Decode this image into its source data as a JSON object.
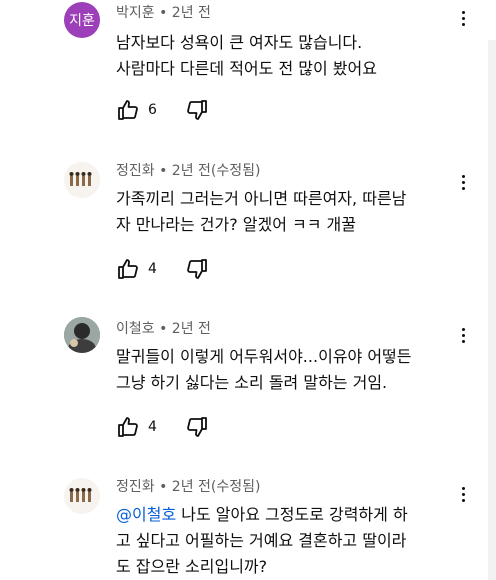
{
  "comments": [
    {
      "avatar_text": "지훈",
      "avatar_color": "#9c3fb8",
      "meta": "박지훈 • 2년 전",
      "lines": [
        "남자보다 성욕이 큰 여자도 많습니다.",
        "사람마다 다른데 적어도 전 많이 봤어요"
      ],
      "likes": "6"
    },
    {
      "meta": "정진화 • 2년 전(수정됨)",
      "lines": [
        "가족끼리 그러는거 아니면 따른여자, 따른남",
        "자 만나라는 건가? 알겠어 ㅋㅋ 개꿀"
      ],
      "likes": "4"
    },
    {
      "meta": "이철호 • 2년 전",
      "lines": [
        "말귀들이 이렇게 어두워서야...이유야 어떻든",
        "그냥  하기 싫다는 소리 돌려 말하는 거임."
      ],
      "likes": "4"
    },
    {
      "meta": "정진화 • 2년 전(수정됨)",
      "mention": "@이철호",
      "first_line_rest": " 나도 알아요 그정도로 강력하게 하",
      "lines_rest": [
        "고 싶다고 어필하는 거예요 결혼하고 딸이라",
        "도 잡으란 소리입니까?"
      ]
    }
  ],
  "icons": {
    "like": "thumb-up-icon",
    "dislike": "thumb-down-icon",
    "menu": "more-vert-icon"
  }
}
